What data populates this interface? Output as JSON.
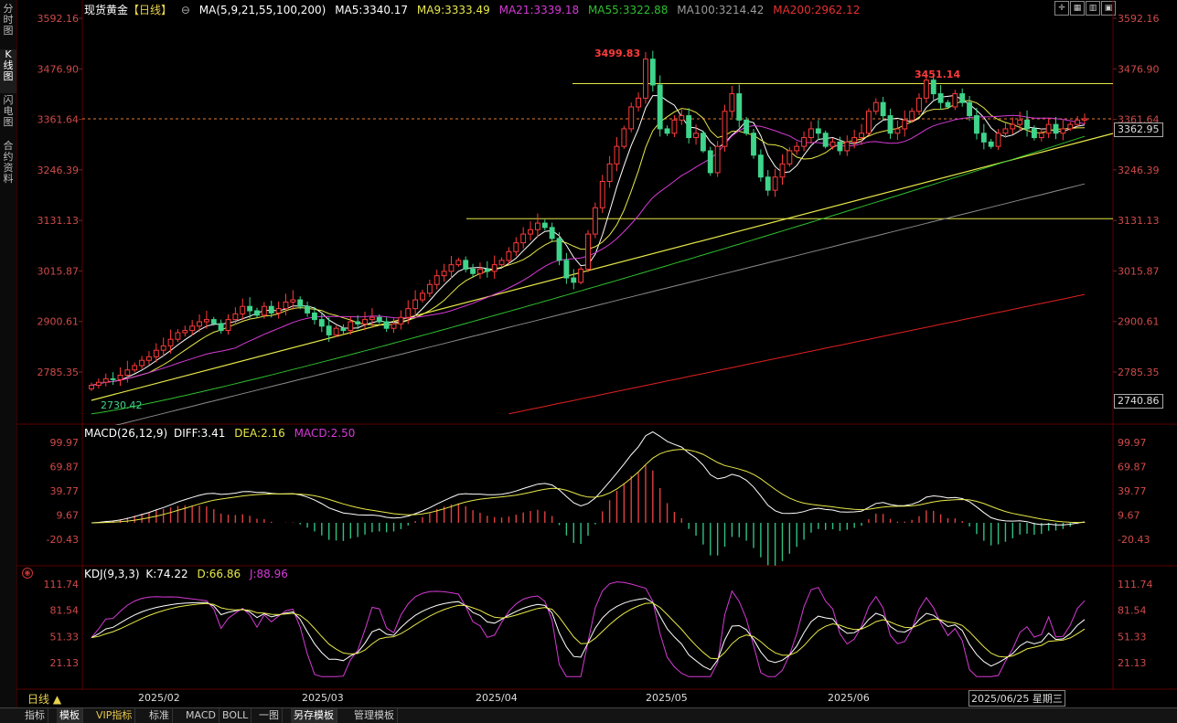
{
  "left_tabs": [
    "分时图",
    "K线图",
    "闪电图",
    "合约资料"
  ],
  "header": {
    "symbol": "现货黄金",
    "period": "【日线】",
    "circle_icon": "⊖",
    "ma_title": "MA(5,9,21,55,100,200)",
    "ma5": "MA5:3340.17",
    "ma9": "MA9:3333.49",
    "ma21": "MA21:3339.18",
    "ma55": "MA55:3322.88",
    "ma100": "MA100:3214.42",
    "ma200": "MA200:2962.12"
  },
  "colors": {
    "up": "#ff3b3b",
    "down": "#3fd48b",
    "ma5": "#ffffff",
    "ma9": "#e8e84a",
    "ma21": "#d63ad6",
    "ma55": "#2fbf2f",
    "ma100": "#8c8c8c",
    "ma200": "#e02020"
  },
  "price_axis": {
    "left": [
      "3592.16",
      "3476.90",
      "3361.64",
      "3246.39",
      "3131.13",
      "3015.87",
      "2900.61",
      "2785.35"
    ],
    "right": [
      "3592.16",
      "3476.90",
      "3361.64",
      "3246.39",
      "3131.13",
      "3015.87",
      "2900.61",
      "2785.35"
    ],
    "current_box": "3362.95",
    "bottom_box": "2740.86"
  },
  "annotations": {
    "high": "3499.83",
    "high2": "3451.14",
    "low": "2730.42"
  },
  "macd": {
    "title": "MACD(26,12,9)",
    "diff": "DIFF:3.41",
    "dea": "DEA:2.16",
    "macd": "MACD:2.50",
    "axis": [
      "99.97",
      "69.87",
      "39.77",
      "9.67",
      "-20.43"
    ]
  },
  "kdj": {
    "title": "KDJ(9,3,3)",
    "k": "K:74.22",
    "d": "D:66.86",
    "j": "J:88.96",
    "axis": [
      "111.74",
      "81.54",
      "51.33",
      "21.13"
    ]
  },
  "dates": {
    "period_label": "日线 ▲",
    "months": [
      "2025/02",
      "2025/03",
      "2025/04",
      "2025/05",
      "2025/06"
    ],
    "current": "2025/06/25 星期三"
  },
  "bottom_tabs": [
    "指标",
    "模板",
    "VIP指标",
    "标准",
    "MACD",
    "BOLL",
    "一图",
    "另存模板",
    "管理模板"
  ],
  "chart_data": {
    "type": "candlestick",
    "instrument": "现货黄金",
    "period": "日线",
    "x_range": [
      "2025/01",
      "2025/06/25"
    ],
    "ylim": [
      2730,
      3592.16
    ],
    "high_annotation": 3499.83,
    "high2_annotation": 3451.14,
    "low_annotation": 2730.42,
    "last_close": 3362.95,
    "closes": [
      2755,
      2762,
      2770,
      2768,
      2778,
      2790,
      2800,
      2812,
      2820,
      2835,
      2845,
      2860,
      2875,
      2880,
      2890,
      2900,
      2905,
      2896,
      2880,
      2905,
      2918,
      2935,
      2925,
      2915,
      2935,
      2920,
      2930,
      2945,
      2950,
      2935,
      2920,
      2905,
      2890,
      2870,
      2885,
      2880,
      2900,
      2895,
      2905,
      2910,
      2900,
      2885,
      2895,
      2910,
      2930,
      2950,
      2965,
      2985,
      3005,
      3015,
      3030,
      3040,
      3020,
      3010,
      3020,
      3015,
      3030,
      3040,
      3060,
      3080,
      3100,
      3110,
      3125,
      3115,
      3090,
      3040,
      3000,
      2990,
      3020,
      3100,
      3160,
      3220,
      3260,
      3300,
      3340,
      3390,
      3410,
      3499,
      3440,
      3340,
      3330,
      3360,
      3370,
      3320,
      3330,
      3290,
      3240,
      3300,
      3380,
      3420,
      3360,
      3330,
      3280,
      3230,
      3200,
      3230,
      3260,
      3290,
      3300,
      3320,
      3340,
      3330,
      3300,
      3310,
      3290,
      3310,
      3320,
      3330,
      3380,
      3400,
      3370,
      3330,
      3340,
      3360,
      3380,
      3410,
      3451,
      3420,
      3400,
      3390,
      3420,
      3400,
      3370,
      3330,
      3310,
      3300,
      3330,
      3340,
      3350,
      3360,
      3340,
      3320,
      3330,
      3350,
      3330,
      3340,
      3350,
      3360,
      3362.95
    ],
    "ma5_last": 3340.17,
    "ma9_last": 3333.49,
    "ma21_last": 3339.18,
    "ma55_last": 3322.88,
    "ma100_last": 3214.42,
    "ma200_last": 2962.12,
    "horizontal_lines": [
      3443,
      3135
    ],
    "macd_last": {
      "diff": 3.41,
      "dea": 2.16,
      "macd": 2.5
    },
    "kdj_last": {
      "k": 74.22,
      "d": 66.86,
      "j": 88.96
    }
  }
}
